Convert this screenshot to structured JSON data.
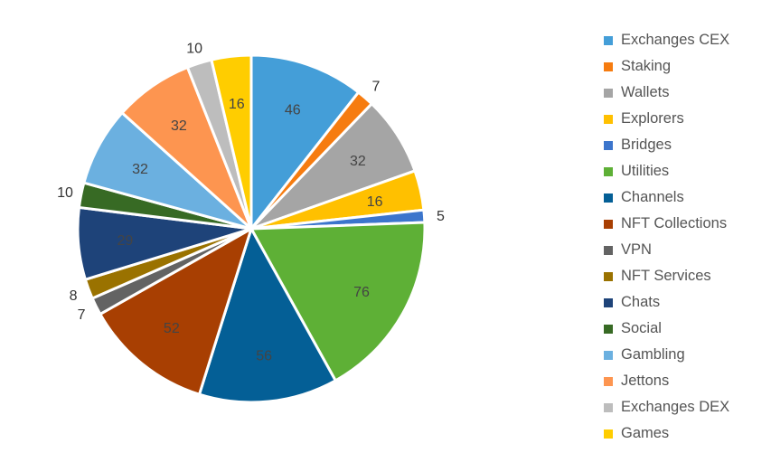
{
  "chart_data": {
    "type": "pie",
    "title": "",
    "legend_position": "right",
    "start_angle_deg": 0,
    "direction": "clockwise",
    "slices": [
      {
        "label": "Exchanges CEX",
        "value": 46,
        "color": "#449ED8",
        "label_pos": "inside"
      },
      {
        "label": "Staking",
        "value": 7,
        "color": "#F67C10",
        "label_pos": "outside"
      },
      {
        "label": "Wallets",
        "value": 32,
        "color": "#A5A5A5",
        "label_pos": "inside"
      },
      {
        "label": "Explorers",
        "value": 16,
        "color": "#FFC000",
        "label_pos": "inside"
      },
      {
        "label": "Bridges",
        "value": 5,
        "color": "#3C75CC",
        "label_pos": "outside"
      },
      {
        "label": "Utilities",
        "value": 76,
        "color": "#5EB036",
        "label_pos": "inside"
      },
      {
        "label": "Channels",
        "value": 56,
        "color": "#045F96",
        "label_pos": "inside"
      },
      {
        "label": "NFT Collections",
        "value": 52,
        "color": "#A83F02",
        "label_pos": "inside"
      },
      {
        "label": "VPN",
        "value": 7,
        "color": "#636363",
        "label_pos": "outside"
      },
      {
        "label": "NFT Services",
        "value": 8,
        "color": "#9A7200",
        "label_pos": "outside"
      },
      {
        "label": "Chats",
        "value": 29,
        "color": "#1E4379",
        "label_pos": "inside"
      },
      {
        "label": "Social",
        "value": 10,
        "color": "#376A24",
        "label_pos": "outside"
      },
      {
        "label": "Gambling",
        "value": 32,
        "color": "#6BB0E0",
        "label_pos": "inside"
      },
      {
        "label": "Jettons",
        "value": 32,
        "color": "#FD9550",
        "label_pos": "inside"
      },
      {
        "label": "Exchanges DEX",
        "value": 10,
        "color": "#BDBDBD",
        "label_pos": "outside"
      },
      {
        "label": "Games",
        "value": 16,
        "color": "#FFCD00",
        "label_pos": "inside"
      }
    ]
  }
}
